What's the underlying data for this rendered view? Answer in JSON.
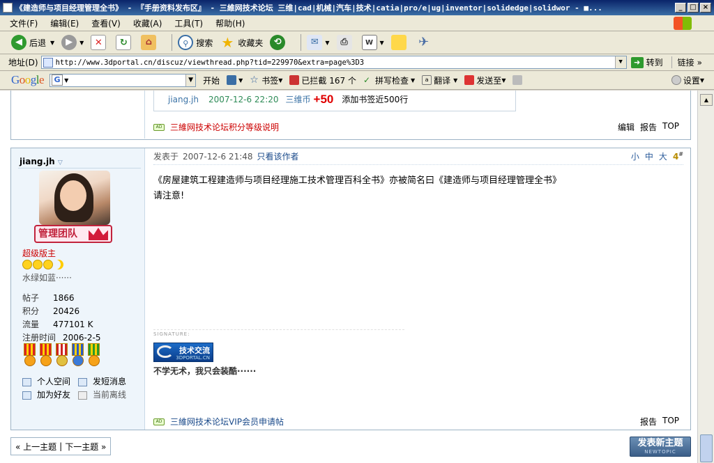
{
  "window": {
    "title": "《建造师与项目经理管理全书》 - 『手册资料发布区』 - 三維网技术论坛 三维|cad|机械|汽车|技术|catia|pro/e|ug|inventor|solidedge|solidwor - ■...",
    "controls": [
      "_",
      "□",
      "×"
    ]
  },
  "menu": [
    "文件(F)",
    "编辑(E)",
    "查看(V)",
    "收藏(A)",
    "工具(T)",
    "帮助(H)"
  ],
  "toolbar": {
    "back": "后退",
    "search": "搜索",
    "favorites": "收藏夹"
  },
  "address": {
    "label": "地址(D)",
    "url": "http://www.3dportal.cn/discuz/viewthread.php?tid=229970&extra=page%3D3",
    "go": "转到",
    "links": "链接"
  },
  "googlebar": {
    "logo": "Google",
    "g": "G",
    "start": "开始",
    "bookmarks": "书签",
    "blocked": "已拦截 167 个",
    "spell": "拼写检查",
    "translate": "翻译",
    "send": "发送至",
    "settings": "设置"
  },
  "prev_post": {
    "user": "jiang.jh",
    "date": "2007-12-6 22:20",
    "coin": "三维币",
    "amount": "+50",
    "note": "添加书签近500行",
    "ad": "三維网技术论坛积分等级说明",
    "actions": [
      "编辑",
      "报告",
      "TOP"
    ]
  },
  "post": {
    "username": "jiang.jh",
    "caret": "▽",
    "team_badge": "管理团队",
    "rank": "超级版主",
    "motto": "水绿如蓝······",
    "stats": [
      {
        "k": "帖子",
        "v": "1866"
      },
      {
        "k": "积分",
        "v": "20426"
      },
      {
        "k": "流量",
        "v": "477101 K"
      },
      {
        "k": "注册时间",
        "v": "2006-2-5"
      }
    ],
    "user_links": [
      "个人空间",
      "发短消息",
      "加为好友",
      "当前离线"
    ],
    "posted_label": "发表于",
    "date": "2007-12-6 21:48",
    "author_only": "只看该作者",
    "font_sizes": [
      "小",
      "中",
      "大"
    ],
    "floor": "4",
    "floor_mark": "#",
    "body": [
      "《房屋建筑工程建造师与项目经理施工技术管理百科全书》亦被简名曰《建造师与项目经理管理全书》",
      "请注意!"
    ],
    "signature_label": "SIGNATURE:",
    "sig_img_text": "技术交流",
    "sig_img_sub": "3DPORTAL.CN",
    "signature_text": "不学无术，我只会装酷······",
    "ad_tag": "AD",
    "ad": "三維网技术论坛VIP会员申请帖",
    "actions": [
      "报告",
      "TOP"
    ]
  },
  "pager": {
    "prev": "« 上一主题",
    "sep": "|",
    "next": "下一主题 »"
  },
  "new_topic": {
    "label": "发表新主题",
    "sub": "NEWTOPIC"
  }
}
